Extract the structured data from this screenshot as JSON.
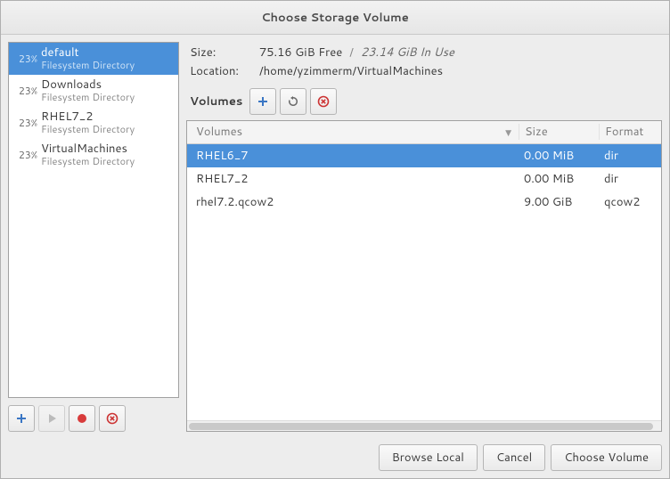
{
  "title": "Choose Storage Volume",
  "info": {
    "size_label": "Size:",
    "free": "75.16 GiB Free",
    "sep": "/",
    "inuse": "23.14 GiB In Use",
    "location_label": "Location:",
    "location": "/home/yzimmerm/VirtualMachines"
  },
  "volumes_label": "Volumes",
  "columns": {
    "volumes": "Volumes",
    "size": "Size",
    "format": "Format"
  },
  "pools": [
    {
      "pct": "23%",
      "name": "default",
      "sub": "Filesystem Directory",
      "selected": true
    },
    {
      "pct": "23%",
      "name": "Downloads",
      "sub": "Filesystem Directory",
      "selected": false
    },
    {
      "pct": "23%",
      "name": "RHEL7_2",
      "sub": "Filesystem Directory",
      "selected": false
    },
    {
      "pct": "23%",
      "name": "VirtualMachines",
      "sub": "Filesystem Directory",
      "selected": false
    }
  ],
  "volumes": [
    {
      "name": "RHEL6_7",
      "size": "0.00 MiB",
      "format": "dir",
      "selected": true
    },
    {
      "name": "RHEL7_2",
      "size": "0.00 MiB",
      "format": "dir",
      "selected": false
    },
    {
      "name": "rhel7.2.qcow2",
      "size": "9.00 GiB",
      "format": "qcow2",
      "selected": false
    }
  ],
  "buttons": {
    "browse_local": "Browse Local",
    "cancel": "Cancel",
    "choose_volume": "Choose Volume"
  },
  "icons": {
    "plus": "plus-icon",
    "play": "play-icon",
    "stop": "stop-icon",
    "delete": "delete-icon",
    "refresh": "refresh-icon"
  }
}
